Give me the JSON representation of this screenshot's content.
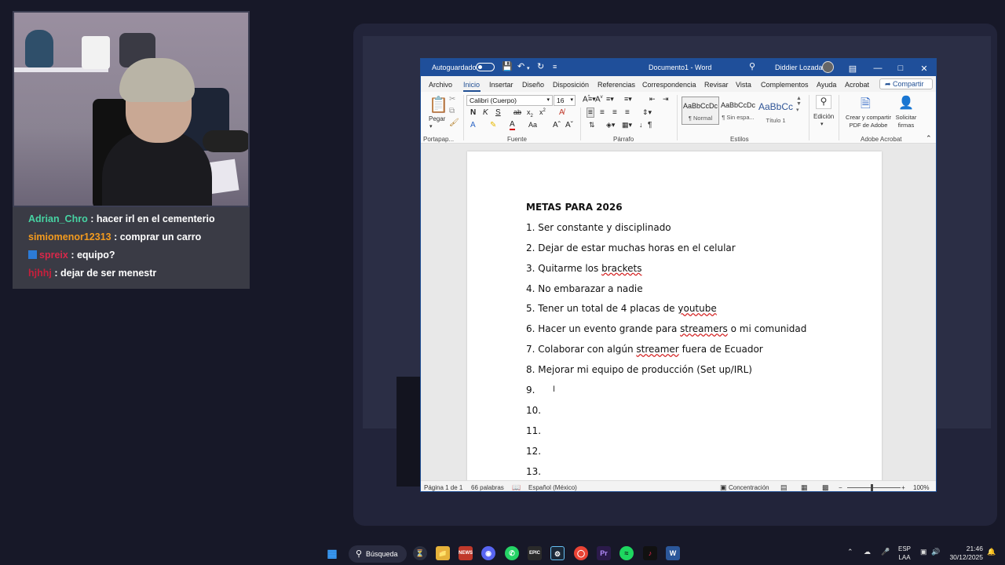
{
  "chat": {
    "messages": [
      {
        "user": "Adrian_Chro",
        "text": ": hacer irl en el cementerio",
        "color": "#47d3a3"
      },
      {
        "user": "simiomenor12313",
        "text": ": comprar un carro",
        "color": "#f39a1e"
      },
      {
        "user": "spreix",
        "text": ": equipo?",
        "color": "#d8284a",
        "badge": "twitch-prime"
      },
      {
        "user": "hjhhj",
        "text": ": dejar de ser menestr",
        "color": "#c81f3c"
      }
    ]
  },
  "word": {
    "autosave_label": "Autoguardado",
    "title": "Documento1 - Word",
    "user": "Diddier Lozada",
    "tabs": [
      "Archivo",
      "Inicio",
      "Insertar",
      "Diseño",
      "Disposición",
      "Referencias",
      "Correspondencia",
      "Revisar",
      "Vista",
      "Complementos",
      "Ayuda",
      "Acrobat"
    ],
    "share_label": "Compartir",
    "ribbon": {
      "paste_label": "Pegar",
      "font_name": "Calibri (Cuerpo)",
      "font_size": "16",
      "groups": {
        "clipboard": "Portapap...",
        "font": "Fuente",
        "paragraph": "Párrafo",
        "styles": "Estilos",
        "acrobat": "Adobe Acrobat"
      },
      "styles": [
        {
          "preview": "AaBbCcDc",
          "name": "¶ Normal"
        },
        {
          "preview": "AaBbCcDc",
          "name": "¶ Sin espa..."
        },
        {
          "preview": "AaBbCc",
          "name": "Título 1"
        }
      ],
      "editing_label": "Edición",
      "acrobat_create": [
        "Crear y compartir",
        "PDF de Adobe"
      ],
      "acrobat_sign": [
        "Solicitar",
        "firmas"
      ]
    },
    "document": {
      "title": "METAS PARA 2026",
      "items": [
        {
          "num": "1.",
          "parts": [
            {
              "t": "Ser constante y disciplinado"
            }
          ]
        },
        {
          "num": "2.",
          "parts": [
            {
              "t": "Dejar de estar muchas horas en el celular"
            }
          ]
        },
        {
          "num": "3.",
          "parts": [
            {
              "t": "Quitarme los "
            },
            {
              "t": "brackets",
              "sq": true
            }
          ]
        },
        {
          "num": "4.",
          "parts": [
            {
              "t": "No embarazar a nadie"
            }
          ]
        },
        {
          "num": "5.",
          "parts": [
            {
              "t": "Tener un total de 4 placas de "
            },
            {
              "t": "youtube",
              "sq": true
            }
          ]
        },
        {
          "num": "6.",
          "parts": [
            {
              "t": "Hacer un evento grande para "
            },
            {
              "t": "streamers",
              "sq": true
            },
            {
              "t": " o mi comunidad"
            }
          ]
        },
        {
          "num": "7.",
          "parts": [
            {
              "t": "Colaborar con algún "
            },
            {
              "t": "streamer",
              "sq": true
            },
            {
              "t": " fuera de Ecuador"
            }
          ]
        },
        {
          "num": "8.",
          "parts": [
            {
              "t": "Mejorar mi equipo de producción (Set up/IRL)"
            }
          ]
        },
        {
          "num": "9.",
          "parts": []
        },
        {
          "num": "10.",
          "parts": []
        },
        {
          "num": "11.",
          "parts": []
        },
        {
          "num": "12.",
          "parts": []
        },
        {
          "num": "13.",
          "parts": []
        }
      ]
    },
    "status": {
      "page": "Página 1 de 1",
      "words": "66 palabras",
      "language": "Español (México)",
      "focus": "Concentración",
      "zoom": "100%",
      "zoom_level": 1.0
    }
  },
  "taskbar": {
    "search_label": "Búsqueda",
    "lang_top": "ESP",
    "lang_bottom": "LAA",
    "time": "21:46",
    "date": "30/12/2025"
  }
}
